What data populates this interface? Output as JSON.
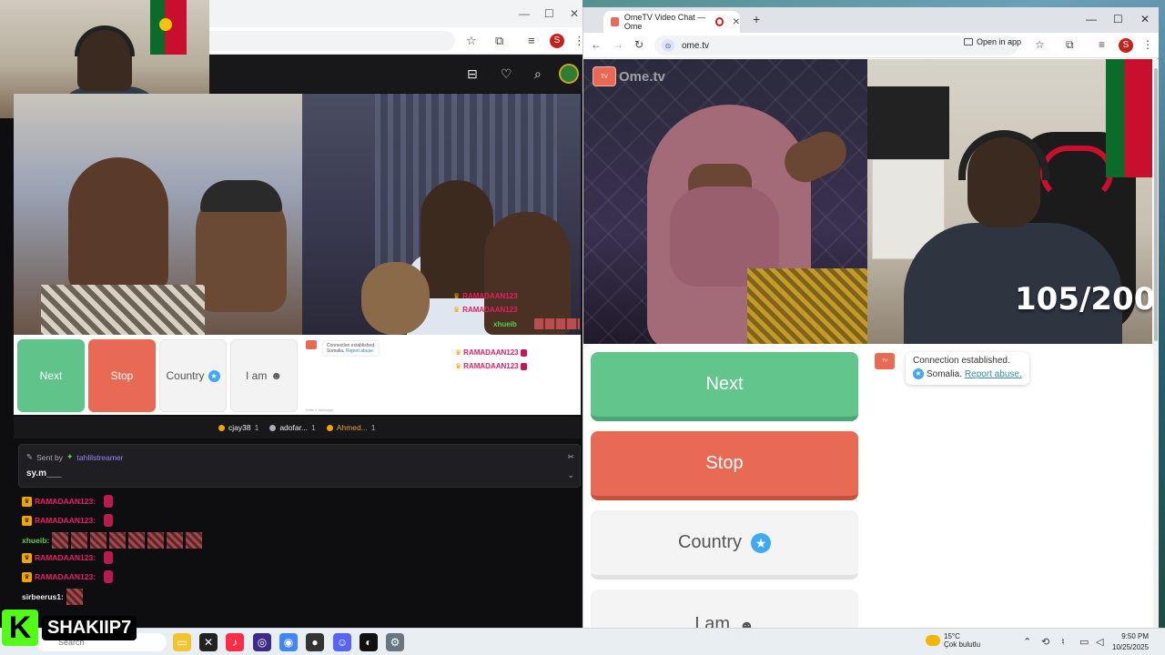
{
  "left_window": {
    "stream_overlay_lines": [
      "RAMADAAN123",
      "RAMADAAN123"
    ],
    "stream_overlay_user": "xhueib",
    "inner_buttons": {
      "next": "Next",
      "stop": "Stop",
      "country": "Country",
      "iam": "I am"
    },
    "inner_chat": {
      "connection_text": "Connection established.",
      "country_line": "Somalia.",
      "report": "Report abuse.",
      "messages": [
        "RAMADAAN123",
        "RAMADAAN123"
      ],
      "hint": "Write a message"
    },
    "viewer_chips": [
      {
        "name": "cjay38",
        "count": "1"
      },
      {
        "name": "adofar...",
        "count": "1"
      },
      {
        "name": "Ahmed...",
        "count": "1"
      }
    ],
    "pinned": {
      "sent_by": "Sent by",
      "sender": "tahlilstreamer",
      "message": "sy.m___"
    },
    "chat_lines": [
      {
        "user": "RAMADAAN123:",
        "type": "red"
      },
      {
        "user": "RAMADAAN123:",
        "type": "red"
      },
      {
        "user": "xhueib:",
        "type": "green"
      },
      {
        "user": "RAMADAAN123:",
        "type": "red"
      },
      {
        "user": "RAMADAAN123:",
        "type": "red"
      },
      {
        "user": "sirbeerus1:",
        "type": "white"
      }
    ]
  },
  "right_window": {
    "tab_title": "OmeTV Video Chat — Ome",
    "url": "ome.tv",
    "open_in_app": "Open in app",
    "avatar_letter": "S",
    "logo_text": "Ome.tv",
    "counter": "105/200",
    "buttons": {
      "next": "Next",
      "stop": "Stop",
      "country": "Country",
      "iam": "I am"
    },
    "chat": {
      "connection": "Connection established.",
      "country": "Somalia.",
      "report": "Report abuse."
    }
  },
  "taskbar": {
    "search_placeholder": "Search",
    "weather_temp": "15°C",
    "weather_desc": "Çok bulutlu",
    "time": "9:50 PM",
    "date": "10/25/2025"
  },
  "watermark": {
    "letter": "K",
    "name": "SHAKIIP7"
  },
  "colors": {
    "next_green": "#62c58c",
    "stop_red": "#e86a55",
    "star_blue": "#3fa9f5",
    "twitch_bg": "#18181b",
    "kick_green": "#53fc18"
  }
}
